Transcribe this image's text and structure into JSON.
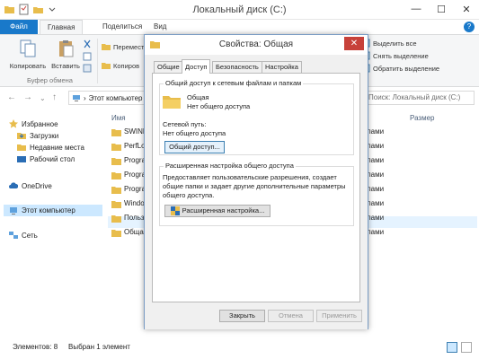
{
  "window": {
    "title": "Локальный диск (C:)",
    "controls": {
      "minimize": "—",
      "maximize": "☐",
      "close": "✕"
    }
  },
  "ribbon_tabs": {
    "file": "Файл",
    "home": "Главная",
    "share": "Поделиться",
    "view": "Вид",
    "help": "?"
  },
  "ribbon": {
    "copy": "Копировать",
    "paste": "Вставить",
    "clipboard_group": "Буфер обмена",
    "move": "Перемест",
    "copy_to": "Копиров",
    "select_all": "Выделить все",
    "select_none": "Снять выделение",
    "invert_selection": "Обратить выделение"
  },
  "address": {
    "path": "Этот компьютер",
    "search_placeholder": "Поиск: Локальный диск (C:)"
  },
  "nav": {
    "favorites": "Избранное",
    "downloads": "Загрузки",
    "recent": "Недавние места",
    "desktop": "Рабочий стол",
    "onedrive": "OneDrive",
    "this_pc": "Этот компьютер",
    "network": "Сеть"
  },
  "columns": {
    "name": "Имя",
    "size": "Размер"
  },
  "files": [
    {
      "name": "SWIND",
      "type": "лами"
    },
    {
      "name": "PerfLo",
      "type": "лами"
    },
    {
      "name": "Progra",
      "type": "лами"
    },
    {
      "name": "Progra",
      "type": "лами"
    },
    {
      "name": "Progra",
      "type": "лами"
    },
    {
      "name": "Windo",
      "type": "лами"
    },
    {
      "name": "Польз",
      "type": "лами"
    },
    {
      "name": "Обща",
      "type": "лами"
    }
  ],
  "status": {
    "items": "Элементов: 8",
    "selected": "Выбран 1 элемент"
  },
  "dialog": {
    "title": "Свойства: Общая",
    "close": "✕",
    "tabs": [
      "Общие",
      "Доступ",
      "Безопасность",
      "Настройка"
    ],
    "network_group": "Общий доступ к сетевым файлам и папкам",
    "folder_name": "Общая",
    "share_state": "Нет общего доступа",
    "network_path_label": "Сетевой путь:",
    "network_path_value": "Нет общего доступа",
    "share_button": "Общий доступ...",
    "advanced_group": "Расширенная настройка общего доступа",
    "advanced_desc": [
      "Предоставляет пользовательские разрешения, создает",
      "общие папки и задает другие дополнительные параметры",
      "общего доступа."
    ],
    "advanced_button": "Расширенная настройка...",
    "ok": "Закрыть",
    "cancel": "Отмена",
    "apply": "Применить"
  },
  "colors": {
    "accent": "#1979ca",
    "close_red": "#c7413a",
    "selection": "#cce8ff",
    "folder": "#e8bd4c"
  }
}
